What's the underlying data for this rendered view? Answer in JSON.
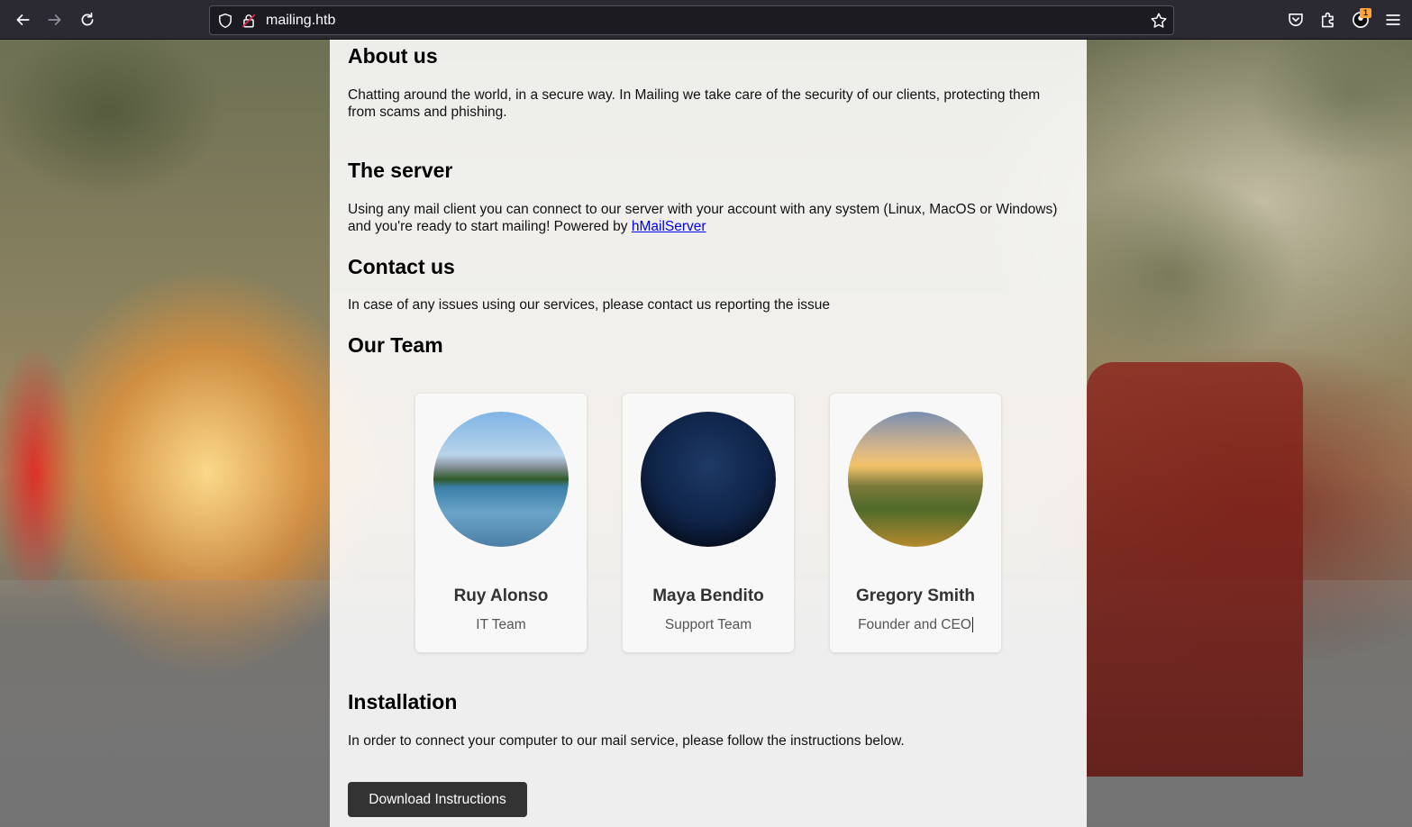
{
  "browser": {
    "url": "mailing.htb",
    "extensions_badge": "1"
  },
  "icons": {
    "back": "arrow-left-icon",
    "forward": "arrow-right-icon",
    "reload": "reload-icon",
    "shield": "shield-icon",
    "lock": "lock-icon",
    "bookmark": "star-icon",
    "pocket": "pocket-icon",
    "extensions": "puzzle-icon",
    "account": "account-icon",
    "menu": "hamburger-menu-icon"
  },
  "sections": {
    "about": {
      "title": "About us",
      "text": "Chatting around the world, in a secure way. In Mailing we take care of the security of our clients, protecting them from scams and phishing."
    },
    "server": {
      "title": "The server",
      "text_before_link": "Using any mail client you can connect to our server with your account with any system (Linux, MacOS or Windows) and you're ready to start mailing! Powered by ",
      "link_text": "hMailServer"
    },
    "contact": {
      "title": "Contact us",
      "text": "In case of any issues using our services, please contact us reporting the issue"
    },
    "team": {
      "title": "Our Team",
      "members": [
        {
          "name": "Ruy Alonso",
          "role": "IT Team"
        },
        {
          "name": "Maya Bendito",
          "role": "Support Team"
        },
        {
          "name": "Gregory Smith",
          "role": "Founder and CEO"
        }
      ]
    },
    "installation": {
      "title": "Installation",
      "text": "In order to connect your computer to our mail service, please follow the instructions below.",
      "button_label": "Download Instructions"
    }
  },
  "colors": {
    "toolbar_bg": "#2b2a33",
    "button_bg": "#333333",
    "link": "#0000ee",
    "badge": "#ffa436"
  }
}
